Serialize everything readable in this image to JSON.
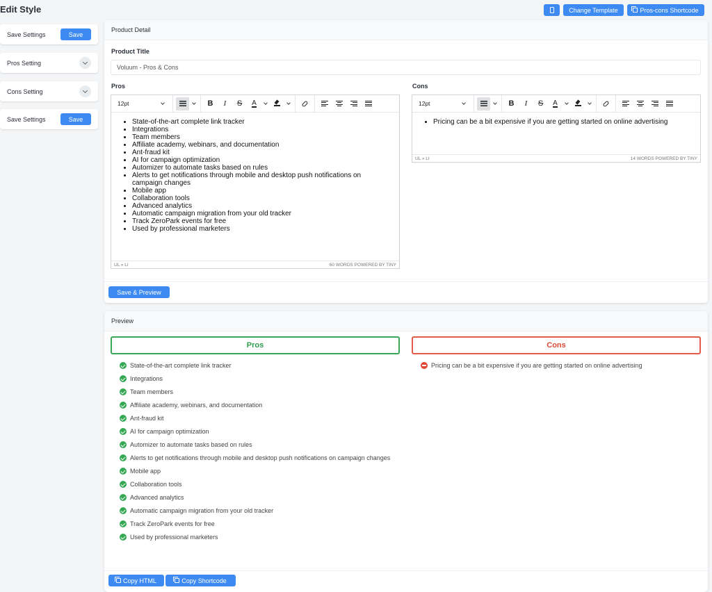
{
  "page": {
    "title": "Edit Style"
  },
  "topbar": {
    "icon_button": "mobile-icon",
    "change_template": "Change Template",
    "shortcode": "Pros-cons Shortcode"
  },
  "sidebar": {
    "save_settings_top": {
      "label": "Save Settings",
      "button": "Save"
    },
    "pros_setting": {
      "label": "Pros Setting"
    },
    "cons_setting": {
      "label": "Cons Setting"
    },
    "save_settings_bottom": {
      "label": "Save Settings",
      "button": "Save"
    }
  },
  "product_detail": {
    "heading": "Product Detail",
    "title_label": "Product Title",
    "title_value": "Voluum  - Pros & Cons",
    "pros_label": "Pros",
    "cons_label": "Cons",
    "font_size": "12pt",
    "pros_items": [
      "State-of-the-art complete link tracker",
      "Integrations",
      "Team members",
      "Affiliate academy, webinars, and documentation",
      "Ant-fraud kit",
      "AI for campaign optimization",
      "Automizer to automate tasks based on rules",
      "Alerts to get notifications through mobile and desktop push notifications on campaign changes",
      "Mobile app",
      "Collaboration tools",
      "Advanced analytics",
      "Automatic campaign migration from your old tracker",
      "Track ZeroPark events for free",
      "Used by professional marketers"
    ],
    "cons_items": [
      "Pricing can be a bit expensive if you are getting started on online advertising"
    ],
    "pros_status_path": "UL » LI",
    "pros_status_words": "60 WORDS  POWERED BY TINY",
    "cons_status_path": "UL » LI",
    "cons_status_words": "14 WORDS  POWERED BY TINY",
    "save_preview": "Save & Preview"
  },
  "preview": {
    "heading": "Preview",
    "pros_title": "Pros",
    "cons_title": "Cons",
    "pros_items": [
      "State-of-the-art complete link tracker",
      "Integrations",
      "Team members",
      "Affiliate academy, webinars, and documentation",
      "Ant-fraud kit",
      "AI for campaign optimization",
      "Automizer to automate tasks based on rules",
      "Alerts to get notifications through mobile and desktop push notifications on campaign changes",
      "Mobile app",
      "Collaboration tools",
      "Advanced analytics",
      "Automatic campaign migration from your old tracker",
      "Track ZeroPark events for free",
      "Used by professional marketers"
    ],
    "cons_items": [
      "Pricing can be a bit expensive if you are getting started on online advertising"
    ],
    "copy_html": "Copy HTML",
    "copy_shortcode": "Copy Shortcode"
  },
  "colors": {
    "accent": "#3d8bf2",
    "pros_green": "#34a853",
    "cons_red": "#e04836"
  }
}
